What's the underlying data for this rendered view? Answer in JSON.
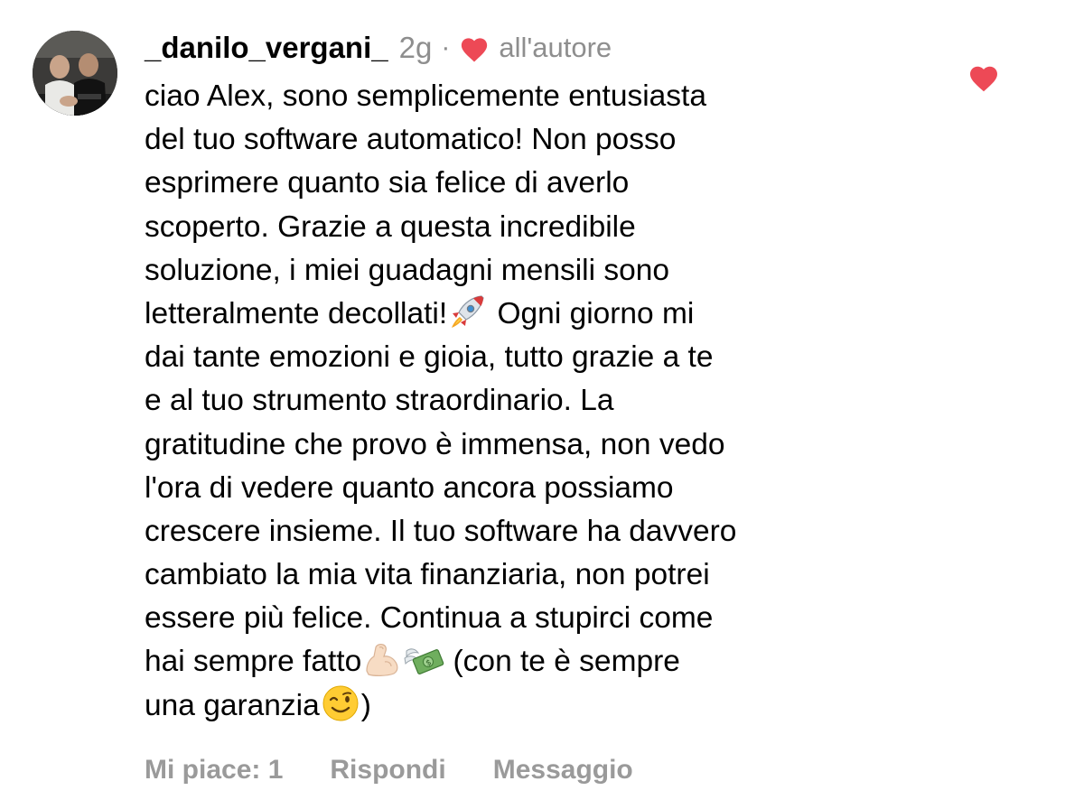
{
  "comment": {
    "username": "_danilo_vergani_",
    "time": "2g",
    "separator": "·",
    "author_label": "all'autore",
    "author_heart_icon": "heart-filled-icon",
    "like_icon": "heart-filled-icon",
    "heart_color": "#ed4956",
    "lines": [
      "ciao Alex, sono semplicemente entusiasta",
      "del tuo software automatico! Non posso",
      "esprimere quanto sia felice di averlo",
      "scoperto. Grazie a questa incredibile",
      "soluzione, i miei guadagni mensili sono",
      {
        "before": "letteralmente decollati!",
        "emoji": "rocket-emoji",
        "after": "  Ogni giorno mi"
      },
      "dai tante emozioni e gioia, tutto grazie a te",
      "e al tuo strumento straordinario. La",
      "gratitudine che provo è immensa, non vedo",
      "l'ora di vedere quanto ancora possiamo",
      "crescere insieme. Il tuo software ha davvero",
      "cambiato la mia vita finanziaria,  non potrei",
      "essere più felice. Continua a stupirci come",
      {
        "before": "hai sempre fatto",
        "emoji": "flexed-biceps-emoji",
        "emoji2": "money-with-wings-emoji",
        "after": "  (con te è sempre"
      },
      {
        "before": "una garanzia",
        "emoji": "winking-face-emoji",
        "after": ")"
      }
    ]
  },
  "actions": {
    "likes": "Mi piace: 1",
    "reply": "Rispondi",
    "message": "Messaggio"
  }
}
